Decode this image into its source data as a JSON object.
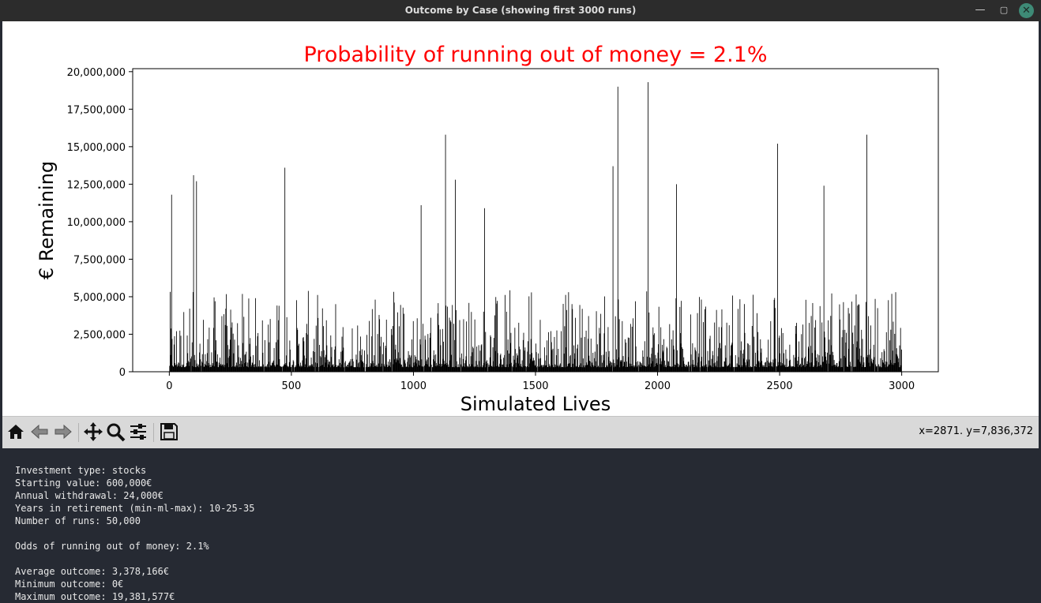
{
  "window": {
    "title": "Outcome by Case (showing first 3000 runs)"
  },
  "chart_data": {
    "type": "bar",
    "title": "Probability of running out of money = 2.1%",
    "title_color": "#ff0000",
    "xlabel": "Simulated Lives",
    "ylabel": "€ Remaining",
    "xlim": [
      -150,
      3150
    ],
    "ylim": [
      0,
      20200000
    ],
    "xticks": [
      0,
      500,
      1000,
      1500,
      2000,
      2500,
      3000
    ],
    "xtick_labels": [
      "0",
      "500",
      "1000",
      "1500",
      "2000",
      "2500",
      "3000"
    ],
    "yticks": [
      0,
      2500000,
      5000000,
      7500000,
      10000000,
      12500000,
      15000000,
      17500000,
      20000000
    ],
    "ytick_labels": [
      "0",
      "2,500,000",
      "5,000,000",
      "7,500,000",
      "10,000,000",
      "12,500,000",
      "15,000,000",
      "17,500,000",
      "20,000,000"
    ],
    "bar_color": "#000000",
    "num_runs_shown": 3000,
    "approx_peak_bars": [
      {
        "x": 8,
        "y": 11800000
      },
      {
        "x": 98,
        "y": 13100000
      },
      {
        "x": 110,
        "y": 12700000
      },
      {
        "x": 472,
        "y": 13600000
      },
      {
        "x": 1030,
        "y": 11100000
      },
      {
        "x": 1130,
        "y": 15800000
      },
      {
        "x": 1170,
        "y": 12800000
      },
      {
        "x": 1290,
        "y": 10900000
      },
      {
        "x": 1815,
        "y": 13700000
      },
      {
        "x": 1835,
        "y": 19000000
      },
      {
        "x": 1960,
        "y": 19300000
      },
      {
        "x": 2075,
        "y": 12500000
      },
      {
        "x": 2490,
        "y": 15200000
      },
      {
        "x": 2680,
        "y": 12400000
      },
      {
        "x": 2855,
        "y": 15800000
      }
    ]
  },
  "toolbar": {
    "buttons": [
      {
        "name": "home-button",
        "icon": "home-icon"
      },
      {
        "name": "back-button",
        "icon": "arrow-left-icon"
      },
      {
        "name": "forward-button",
        "icon": "arrow-right-icon"
      },
      {
        "name": "pan-button",
        "icon": "move-icon"
      },
      {
        "name": "zoom-button",
        "icon": "zoom-icon"
      },
      {
        "name": "configure-subplots-button",
        "icon": "sliders-icon"
      },
      {
        "name": "save-button",
        "icon": "floppy-disk-icon"
      }
    ],
    "coordinates": "x=2871. y=7,836,372"
  },
  "console": {
    "lines": [
      "Investment type: stocks",
      "Starting value: 600,000€",
      "Annual withdrawal: 24,000€",
      "Years in retirement (min-ml-max): 10-25-35",
      "Number of runs: 50,000",
      "",
      "Odds of running out of money: 2.1%",
      "",
      "Average outcome: 3,378,166€",
      "Minimum outcome: 0€",
      "Maximum outcome: 19,381,577€"
    ]
  }
}
